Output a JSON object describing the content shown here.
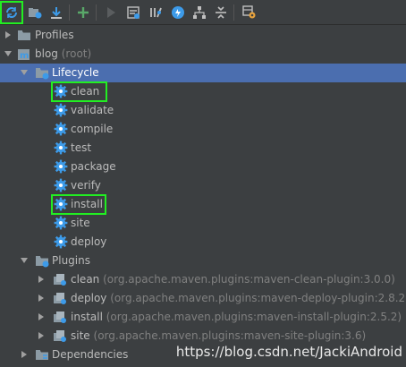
{
  "toolbar": {
    "buttons": [
      "refresh-icon",
      "generate-sources-icon",
      "download-icon",
      "add-icon",
      "run-icon",
      "execute-goal-icon",
      "toggle-offline-icon",
      "skip-tests-icon",
      "dependencies-diagram-icon",
      "collapse-all-icon",
      "settings-icon"
    ]
  },
  "tree": {
    "profiles": "Profiles",
    "project": {
      "name": "blog",
      "suffix": "(root)"
    },
    "lifecycle": {
      "label": "Lifecycle",
      "phases": [
        "clean",
        "validate",
        "compile",
        "test",
        "package",
        "verify",
        "install",
        "site",
        "deploy"
      ]
    },
    "plugins": {
      "label": "Plugins",
      "items": [
        {
          "name": "clean",
          "coords": "(org.apache.maven.plugins:maven-clean-plugin:3.0.0)"
        },
        {
          "name": "deploy",
          "coords": "(org.apache.maven.plugins:maven-deploy-plugin:2.8.2)"
        },
        {
          "name": "install",
          "coords": "(org.apache.maven.plugins:maven-install-plugin:2.5.2)"
        },
        {
          "name": "site",
          "coords": "(org.apache.maven.plugins:maven-site-plugin:3.6)"
        }
      ]
    },
    "dependencies": "Dependencies"
  },
  "watermark": "https://blog.csdn.net/JackiAndroid",
  "colors": {
    "background": "#3c3f41",
    "selection": "#4b6eaf",
    "gear": "#3d9be9",
    "highlight": "#22ee22"
  }
}
